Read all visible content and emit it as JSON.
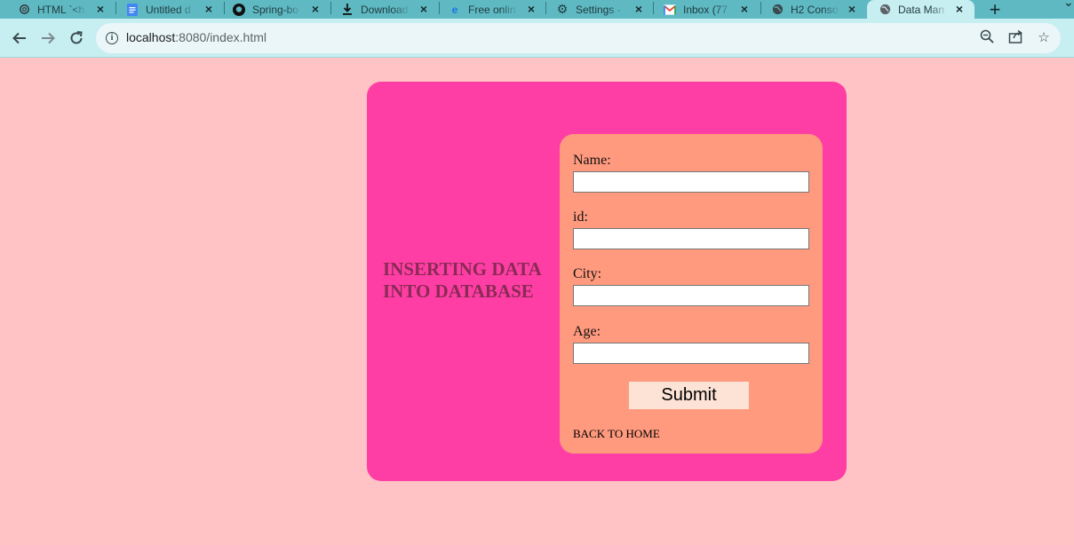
{
  "browser": {
    "tabs": [
      {
        "title": "HTML `<h",
        "icon": "openai-icon"
      },
      {
        "title": "Untitled d",
        "icon": "docs-icon"
      },
      {
        "title": "Spring-bo",
        "icon": "github-icon"
      },
      {
        "title": "Download",
        "icon": "download-icon"
      },
      {
        "title": "Free onlin",
        "icon": "edge-icon"
      },
      {
        "title": "Settings -",
        "icon": "gear-icon"
      },
      {
        "title": "Inbox (77",
        "icon": "gmail-icon"
      },
      {
        "title": "H2 Conso",
        "icon": "globe-icon"
      },
      {
        "title": "Data Man",
        "icon": "globe-icon",
        "active": true
      }
    ],
    "url_host": "localhost",
    "url_path": ":8080/index.html",
    "colors": {
      "tabstrip": "#5fb9c3",
      "toolbar": "#c7eef1"
    }
  },
  "page": {
    "heading": "INSERTING DATA INTO DATABASE",
    "fields": [
      {
        "label": "Name:",
        "value": ""
      },
      {
        "label": "id:",
        "value": ""
      },
      {
        "label": "City:",
        "value": ""
      },
      {
        "label": "Age:",
        "value": ""
      }
    ],
    "submit_label": "Submit",
    "back_link": "BACK TO HOME",
    "colors": {
      "background": "#ffc3c6",
      "card": "#ff3ea5",
      "form": "#ff9a7e",
      "heading": "#8a2a55",
      "button": "#fde3d6"
    }
  }
}
